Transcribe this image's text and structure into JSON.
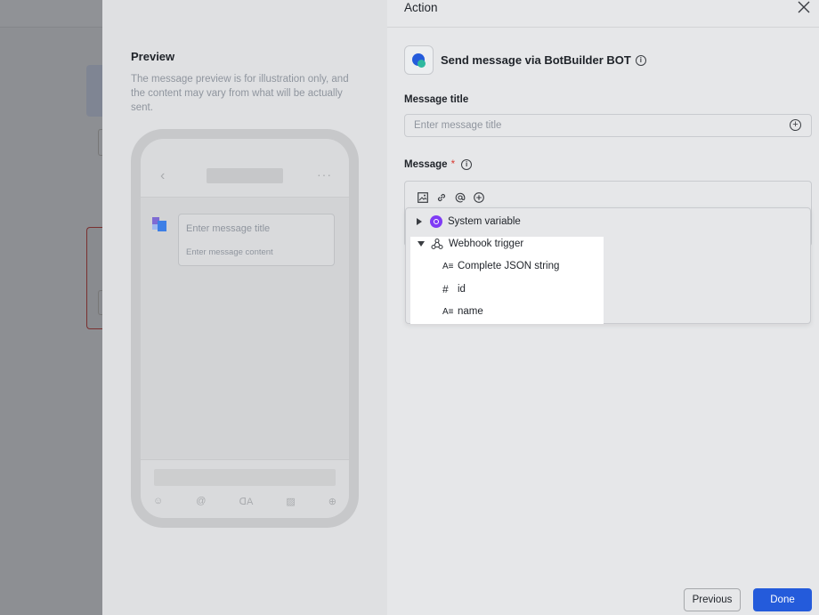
{
  "preview": {
    "title": "Preview",
    "note": "The message preview is for illustration only, and the content may vary from what will be actually sent.",
    "bubble_title": "Enter message title",
    "bubble_content": "Enter message content",
    "back_glyph": "‹",
    "more_glyph": "···",
    "tools": [
      "☺",
      "@",
      "ᗡA",
      "▨",
      "⊕"
    ]
  },
  "action": {
    "title": "Action",
    "bot_label": "Send message via BotBuilder BOT",
    "message_title_label": "Message title",
    "message_title_placeholder": "Enter message title",
    "message_label": "Message",
    "required_mark": "*",
    "info_glyph": "i",
    "plus_glyph": "+"
  },
  "dropdown": {
    "system_variable": "System variable",
    "webhook_trigger": "Webhook trigger",
    "fields": [
      {
        "label": "Complete JSON string",
        "type_glyph": "A≡"
      },
      {
        "label": "id",
        "type_glyph": "#"
      },
      {
        "label": "name",
        "type_glyph": "A≡"
      }
    ]
  },
  "footer": {
    "previous": "Previous",
    "done": "Done"
  },
  "colors": {
    "primary": "#245bdb",
    "required": "#d83931",
    "system_variable": "#7f3bf5"
  }
}
